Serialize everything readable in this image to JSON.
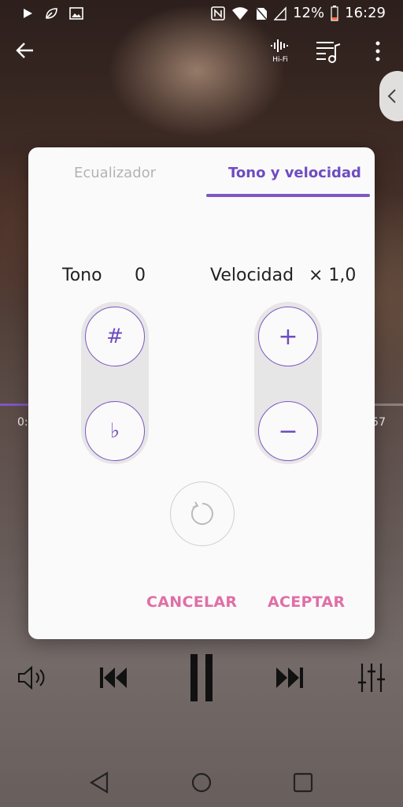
{
  "statusbar": {
    "battery": "12%",
    "time": "16:29"
  },
  "topbar": {
    "hifi_label": "Hi-Fi"
  },
  "player": {
    "elapsed": "0:",
    "total": "57",
    "progress": 0.08
  },
  "dialog": {
    "tabs": [
      {
        "label": "Ecualizador"
      },
      {
        "label": "Tono y velocidad"
      }
    ],
    "tone": {
      "label": "Tono",
      "value": "0"
    },
    "speed": {
      "label": "Velocidad",
      "value": "× 1,0"
    },
    "tone_up_symbol": "#",
    "tone_down_symbol": "♭",
    "speed_up_symbol": "+",
    "speed_down_symbol": "−",
    "cancel_label": "CANCELAR",
    "accept_label": "ACEPTAR"
  },
  "colors": {
    "accent": "#7e57c2",
    "action": "#e06fa7"
  }
}
